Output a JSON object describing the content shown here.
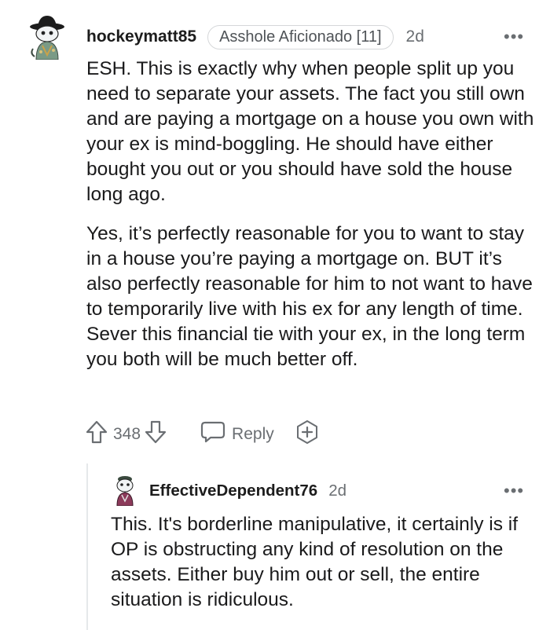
{
  "comment": {
    "username": "hockeymatt85",
    "flair": "Asshole Aficionado [11]",
    "age": "2d",
    "more": "•••",
    "paragraphs": [
      "ESH. This is exactly why when people split up you need to separate your assets. The fact you still own and are paying a mortgage on a house you own with your ex is mind-boggling. He should have either bought you out or you should have sold the house long ago.",
      "Yes, it’s perfectly reasonable for you to want to stay in a house you’re paying a mortgage on. BUT it’s also perfectly reasonable for him to not want to have to temporarily live with his ex for any length of time. Sever this financial tie with your ex, in the long term you both will be much better off."
    ],
    "votes": "348",
    "reply_label": "Reply",
    "icons": {
      "upvote": "upvote-arrow-icon",
      "downvote": "downvote-arrow-icon",
      "reply": "speech-bubble-icon",
      "award": "award-plus-icon"
    }
  },
  "reply": {
    "username": "EffectiveDependent76",
    "age": "2d",
    "more": "•••",
    "text": "This. It's borderline manipulative, it certainly is if OP is obstructing any kind of resolution on the assets. Either buy him out or sell, the entire situation is ridiculous."
  },
  "colors": {
    "text": "#1a1a1b",
    "meta": "#6a6e72",
    "flair_border": "#d5d7d9",
    "thread_line": "#e6e8ea"
  }
}
